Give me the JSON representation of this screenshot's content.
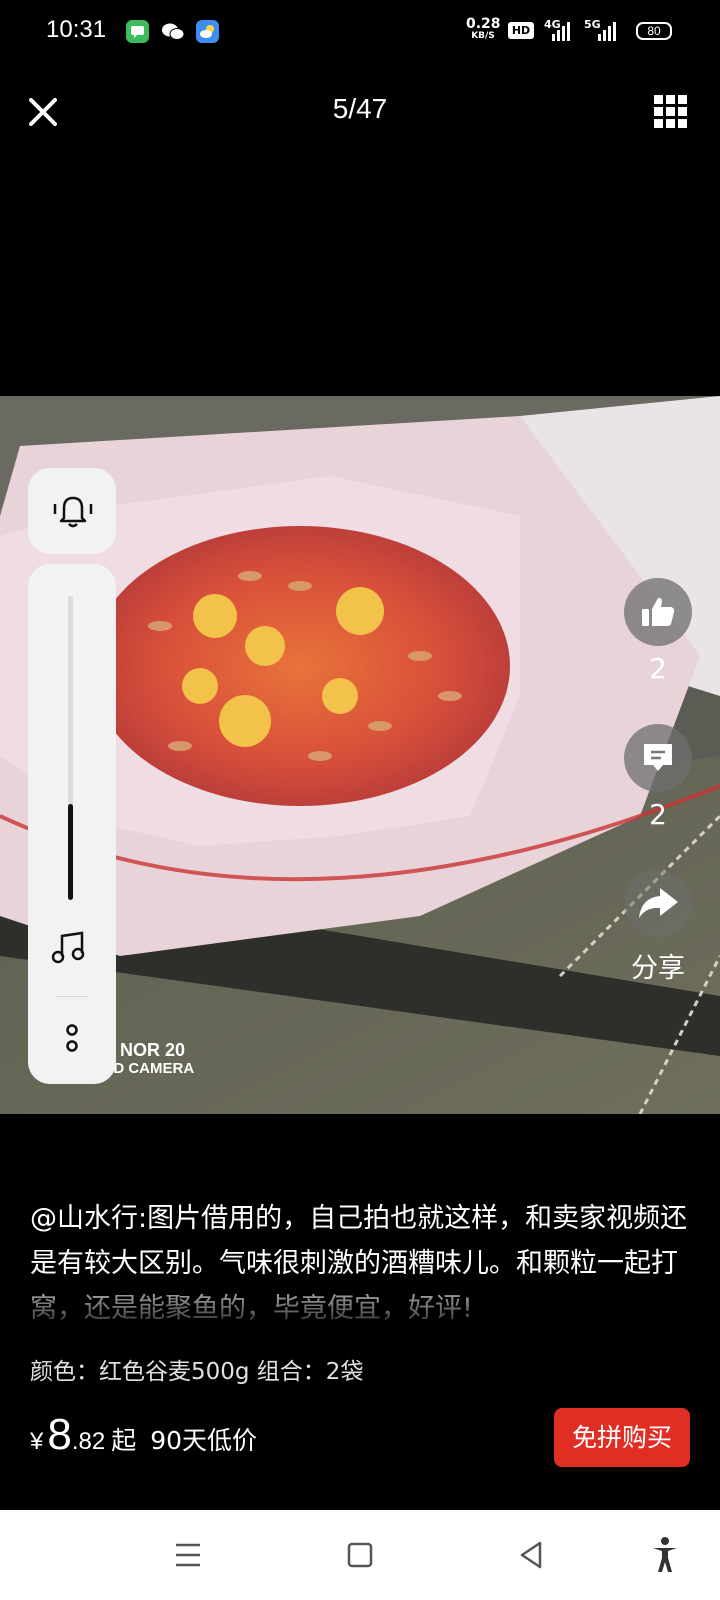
{
  "status_bar": {
    "time": "10:31",
    "speed_value": "0.28",
    "speed_unit": "KB/S",
    "hd": "HD",
    "net1": "4G",
    "net2": "5G",
    "battery": "80"
  },
  "header": {
    "counter": "5/47",
    "close_icon": "close-icon",
    "grid_icon": "grid-icon"
  },
  "photo": {
    "watermark_line1": "NOR 20",
    "watermark_line2": "QUAD CAMERA"
  },
  "actions": {
    "like_count": "2",
    "comment_count": "2",
    "share_label": "分享"
  },
  "review": {
    "text": "@山水行:图片借用的，自己拍也就这样，和卖家视频还是有较大区别。气味很刺激的酒糟味儿。和颗粒一起打窝，还是能聚鱼的，毕竟便宜，好评!"
  },
  "spec": {
    "text": "颜色：红色谷麦500g  组合：2袋"
  },
  "price": {
    "currency": "¥",
    "integer": "8",
    "decimal": ".82",
    "suffix": "起",
    "tag": "90天低价"
  },
  "buy_button": "免拼购买",
  "colors": {
    "accent": "#e02e24",
    "panel": "#f2f2f2"
  }
}
